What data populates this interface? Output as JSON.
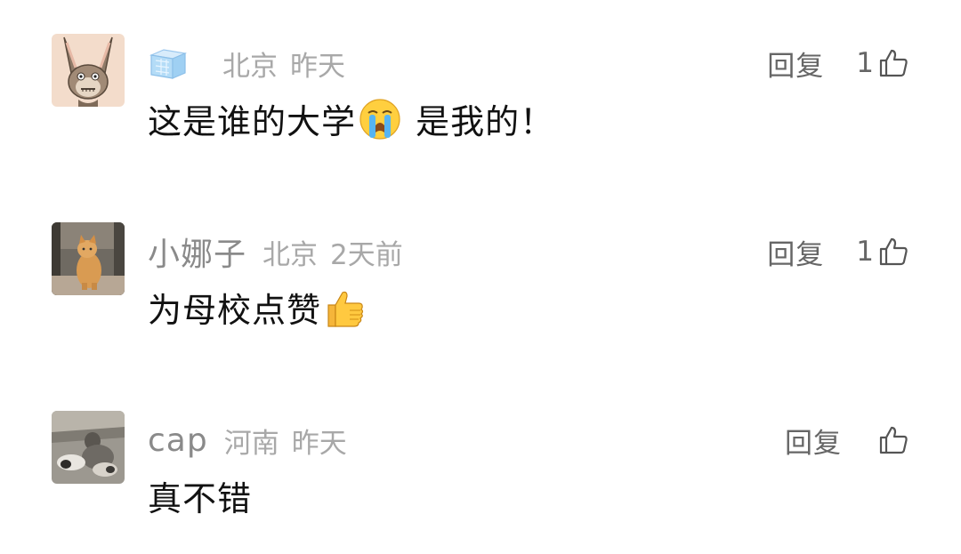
{
  "comments": [
    {
      "nickname": "",
      "location": "北京",
      "time": "昨天",
      "content_before": "这是谁的大学",
      "content_emoji": "crying-face-emoji",
      "content_after": " 是我的！",
      "reply_label": "回复",
      "like_count": "1",
      "avatar_icon": "cartoon-rabbit-avatar",
      "badge_icon": "ice-cube-icon"
    },
    {
      "nickname": "小娜子",
      "location": "北京",
      "time": "2天前",
      "content_before": "为母校点赞",
      "content_emoji": "thumbs-up-emoji",
      "content_after": "",
      "reply_label": "回复",
      "like_count": "1",
      "avatar_icon": "cat-photo-avatar"
    },
    {
      "nickname": "cap",
      "location": "河南",
      "time": "昨天",
      "content_before": "真不错",
      "content_after": "",
      "reply_label": "回复",
      "like_count": "",
      "avatar_icon": "dogs-photo-avatar"
    }
  ],
  "colors": {
    "nickname": "#8a8a8a",
    "meta": "#a8a8a8",
    "content": "#111111",
    "action": "#666666"
  }
}
